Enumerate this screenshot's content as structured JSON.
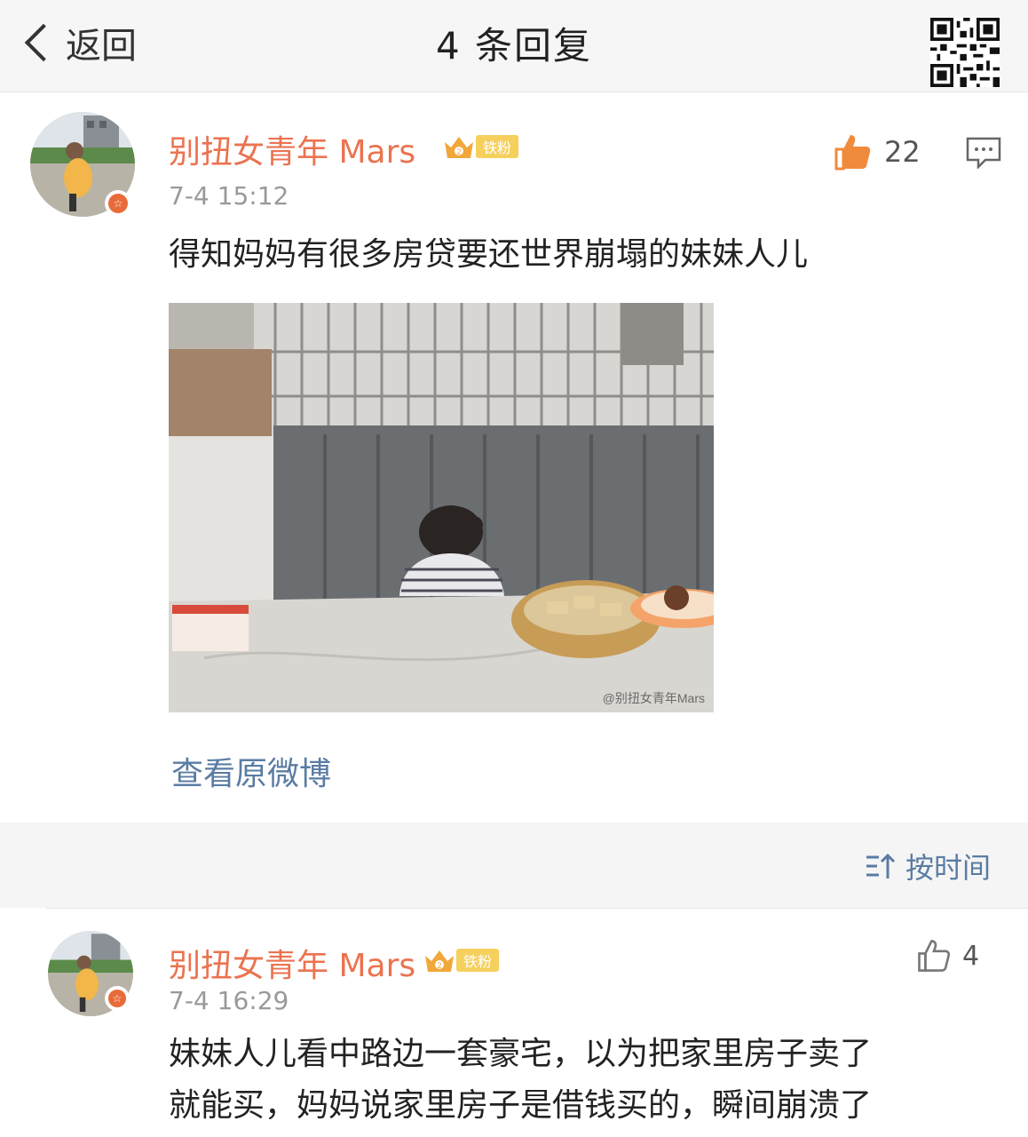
{
  "header": {
    "back_label": "返回",
    "title": "4 条回复"
  },
  "main_comment": {
    "username": "别扭女青年 Mars",
    "badge": "铁粉",
    "timestamp": "7-4 15:12",
    "likes": "22",
    "text": "得知妈妈有很多房贷要还世界崩塌的妹妹人儿",
    "photo_watermark": "@别扭女青年Mars",
    "view_original": "查看原微博"
  },
  "sort": {
    "label": "按时间"
  },
  "reply": {
    "username": "别扭女青年 Mars",
    "badge": "铁粉",
    "timestamp": "7-4 16:29",
    "likes": "4",
    "text_line1": "妹妹人儿看中路边一套豪宅，以为把家里房子卖了",
    "text_line2": "就能买，妈妈说家里房子是借钱买的，瞬间崩溃了"
  },
  "colors": {
    "username": "#eb7350",
    "link": "#5a7ca3",
    "accent_like": "#f08a3c"
  }
}
